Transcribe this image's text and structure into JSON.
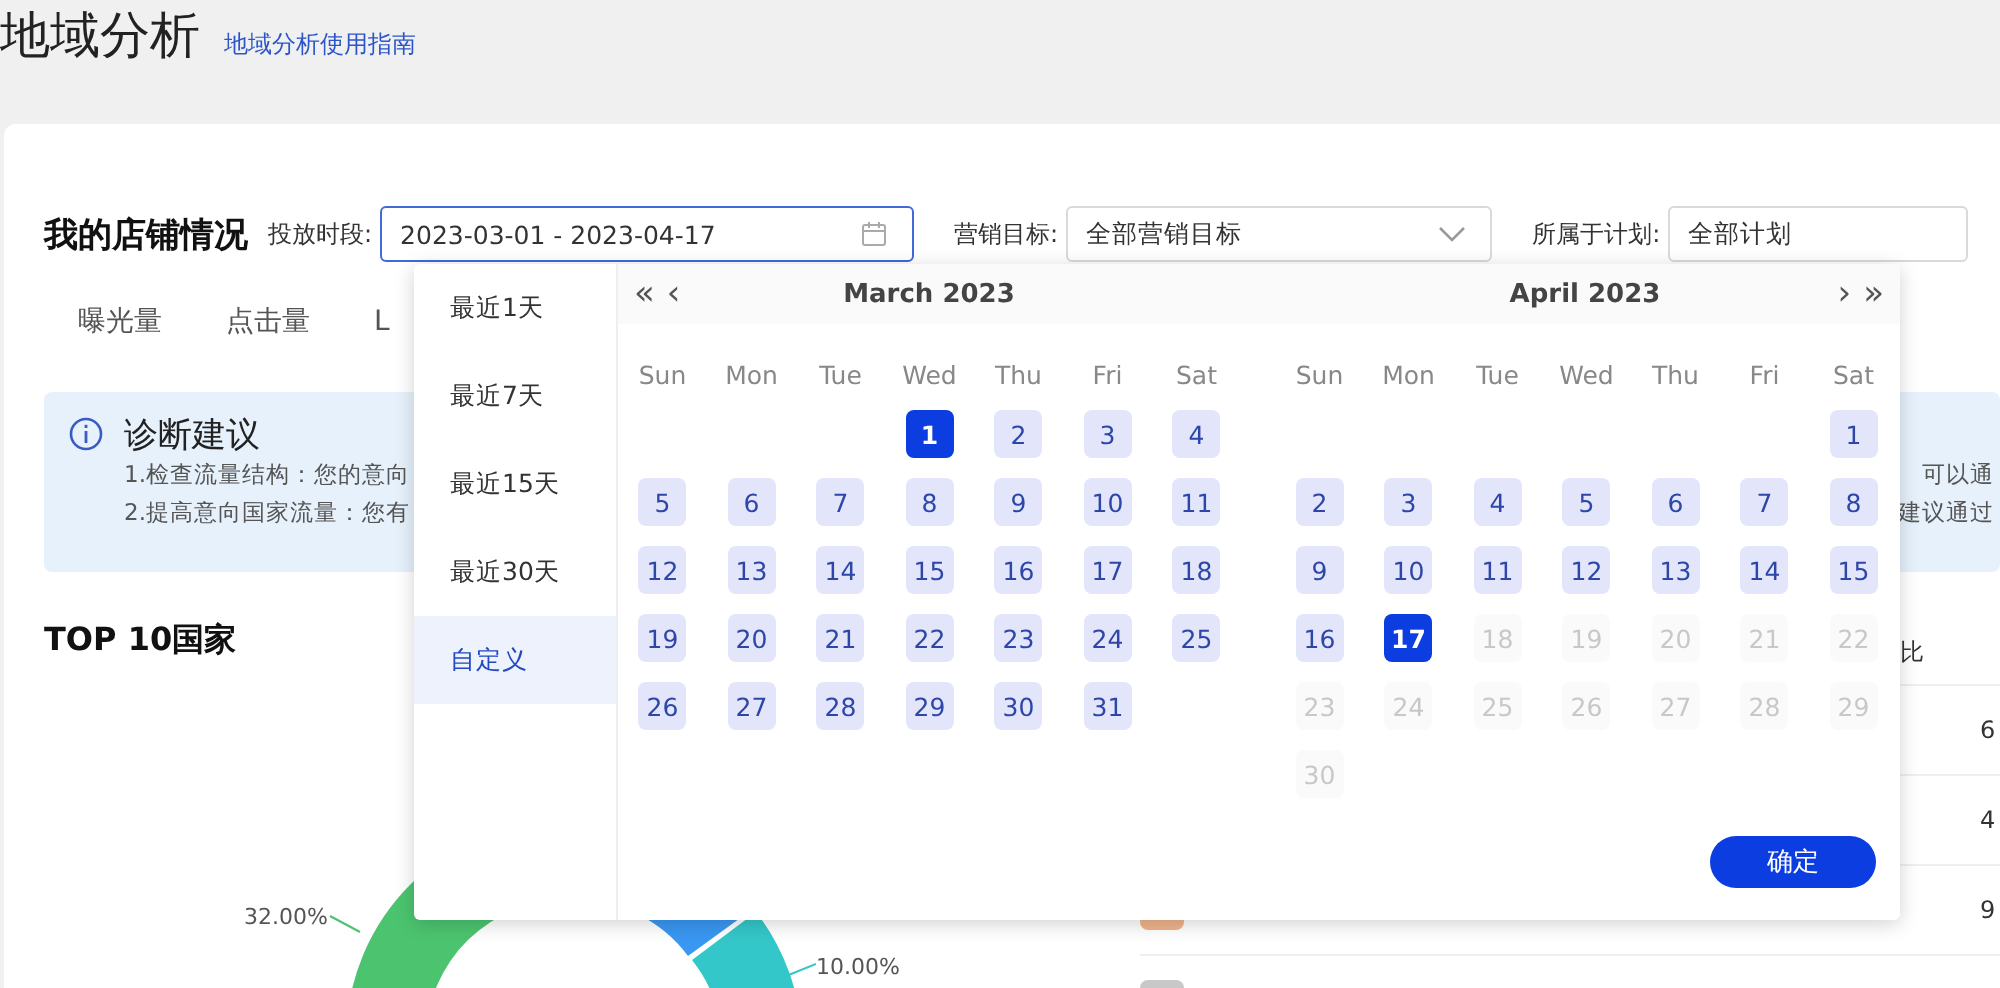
{
  "page_title": "地域分析",
  "guide_link": "地域分析使用指南",
  "store": {
    "heading": "我的店铺情况",
    "period": {
      "label": "投放时段:",
      "value": "2023-03-01 - 2023-04-17"
    },
    "goal": {
      "label": "营销目标:",
      "value": "全部营销目标"
    },
    "plan": {
      "label": "所属于计划:",
      "value": "全部计划"
    }
  },
  "metric_tabs": [
    {
      "label": "曝光量",
      "selected": false
    },
    {
      "label": "点击量",
      "selected": false
    },
    {
      "label": "L",
      "selected": false
    }
  ],
  "advice": {
    "title": "诊断建议",
    "lines": [
      {
        "left": "1.检查流量结构：您的意向",
        "right": "可以通"
      },
      {
        "left": "2.提高意向国家流量：您有",
        "right": "建议通过"
      }
    ]
  },
  "top_countries": {
    "title": "TOP 10国家",
    "donut_labels": [
      "32.00%",
      "10.00%"
    ],
    "columns": [
      "比"
    ],
    "rows": [
      {
        "value": "6"
      },
      {
        "value": "4"
      },
      {
        "value": "9",
        "color": "#f0b48c"
      },
      {
        "color": "#c8c8c8"
      }
    ]
  },
  "date_picker": {
    "presets": [
      {
        "label": "最近1天",
        "selected": false
      },
      {
        "label": "最近7天",
        "selected": false
      },
      {
        "label": "最近15天",
        "selected": false
      },
      {
        "label": "最近30天",
        "selected": false
      },
      {
        "label": "自定义",
        "selected": true
      }
    ],
    "prev_year": "«",
    "prev_month": "‹",
    "next_month": "›",
    "next_year": "»",
    "months": [
      {
        "title": "March  2023",
        "weekdays": [
          "Sun",
          "Mon",
          "Tue",
          "Wed",
          "Thu",
          "Fri",
          "Sat"
        ],
        "weeks": [
          [
            {
              "kind": "empty"
            },
            {
              "kind": "empty"
            },
            {
              "kind": "empty"
            },
            {
              "label": "1",
              "kind": "range",
              "selected": true
            },
            {
              "label": "2",
              "kind": "range",
              "selected": false
            },
            {
              "label": "3",
              "kind": "range",
              "selected": false
            },
            {
              "label": "4",
              "kind": "range",
              "selected": false
            }
          ],
          [
            {
              "label": "5",
              "kind": "range",
              "selected": false
            },
            {
              "label": "6",
              "kind": "range",
              "selected": false
            },
            {
              "label": "7",
              "kind": "range",
              "selected": false
            },
            {
              "label": "8",
              "kind": "range",
              "selected": false
            },
            {
              "label": "9",
              "kind": "range",
              "selected": false
            },
            {
              "label": "10",
              "kind": "range",
              "selected": false
            },
            {
              "label": "11",
              "kind": "range",
              "selected": false
            }
          ],
          [
            {
              "label": "12",
              "kind": "range",
              "selected": false
            },
            {
              "label": "13",
              "kind": "range",
              "selected": false
            },
            {
              "label": "14",
              "kind": "range",
              "selected": false
            },
            {
              "label": "15",
              "kind": "range",
              "selected": false
            },
            {
              "label": "16",
              "kind": "range",
              "selected": false
            },
            {
              "label": "17",
              "kind": "range",
              "selected": false
            },
            {
              "label": "18",
              "kind": "range",
              "selected": false
            }
          ],
          [
            {
              "label": "19",
              "kind": "range",
              "selected": false
            },
            {
              "label": "20",
              "kind": "range",
              "selected": false
            },
            {
              "label": "21",
              "kind": "range",
              "selected": false
            },
            {
              "label": "22",
              "kind": "range",
              "selected": false
            },
            {
              "label": "23",
              "kind": "range",
              "selected": false
            },
            {
              "label": "24",
              "kind": "range",
              "selected": false
            },
            {
              "label": "25",
              "kind": "range",
              "selected": false
            }
          ],
          [
            {
              "label": "26",
              "kind": "range",
              "selected": false
            },
            {
              "label": "27",
              "kind": "range",
              "selected": false
            },
            {
              "label": "28",
              "kind": "range",
              "selected": false
            },
            {
              "label": "29",
              "kind": "range",
              "selected": false
            },
            {
              "label": "30",
              "kind": "range",
              "selected": false
            },
            {
              "label": "31",
              "kind": "range",
              "selected": false
            },
            {
              "kind": "empty"
            }
          ]
        ]
      },
      {
        "title": "April  2023",
        "weekdays": [
          "Sun",
          "Mon",
          "Tue",
          "Wed",
          "Thu",
          "Fri",
          "Sat"
        ],
        "weeks": [
          [
            {
              "kind": "empty"
            },
            {
              "kind": "empty"
            },
            {
              "kind": "empty"
            },
            {
              "kind": "empty"
            },
            {
              "kind": "empty"
            },
            {
              "kind": "empty"
            },
            {
              "label": "1",
              "kind": "range",
              "selected": false
            }
          ],
          [
            {
              "label": "2",
              "kind": "range",
              "selected": false
            },
            {
              "label": "3",
              "kind": "range",
              "selected": false
            },
            {
              "label": "4",
              "kind": "range",
              "selected": false
            },
            {
              "label": "5",
              "kind": "range",
              "selected": false
            },
            {
              "label": "6",
              "kind": "range",
              "selected": false
            },
            {
              "label": "7",
              "kind": "range",
              "selected": false
            },
            {
              "label": "8",
              "kind": "range",
              "selected": false
            }
          ],
          [
            {
              "label": "9",
              "kind": "range",
              "selected": false
            },
            {
              "label": "10",
              "kind": "range",
              "selected": false
            },
            {
              "label": "11",
              "kind": "range",
              "selected": false
            },
            {
              "label": "12",
              "kind": "range",
              "selected": false
            },
            {
              "label": "13",
              "kind": "range",
              "selected": false
            },
            {
              "label": "14",
              "kind": "range",
              "selected": false
            },
            {
              "label": "15",
              "kind": "range",
              "selected": false
            }
          ],
          [
            {
              "label": "16",
              "kind": "range",
              "selected": false
            },
            {
              "label": "17",
              "kind": "range",
              "selected": true
            },
            {
              "label": "18",
              "kind": "disabled",
              "selected": false
            },
            {
              "label": "19",
              "kind": "disabled",
              "selected": false
            },
            {
              "label": "20",
              "kind": "disabled",
              "selected": false
            },
            {
              "label": "21",
              "kind": "disabled",
              "selected": false
            },
            {
              "label": "22",
              "kind": "disabled",
              "selected": false
            }
          ],
          [
            {
              "label": "23",
              "kind": "disabled",
              "selected": false
            },
            {
              "label": "24",
              "kind": "disabled",
              "selected": false
            },
            {
              "label": "25",
              "kind": "disabled",
              "selected": false
            },
            {
              "label": "26",
              "kind": "disabled",
              "selected": false
            },
            {
              "label": "27",
              "kind": "disabled",
              "selected": false
            },
            {
              "label": "28",
              "kind": "disabled",
              "selected": false
            },
            {
              "label": "29",
              "kind": "disabled",
              "selected": false
            }
          ],
          [
            {
              "label": "30",
              "kind": "disabled",
              "selected": false
            },
            {
              "kind": "empty"
            },
            {
              "kind": "empty"
            },
            {
              "kind": "empty"
            },
            {
              "kind": "empty"
            },
            {
              "kind": "empty"
            },
            {
              "kind": "empty"
            }
          ]
        ]
      }
    ],
    "confirm": "确定"
  }
}
